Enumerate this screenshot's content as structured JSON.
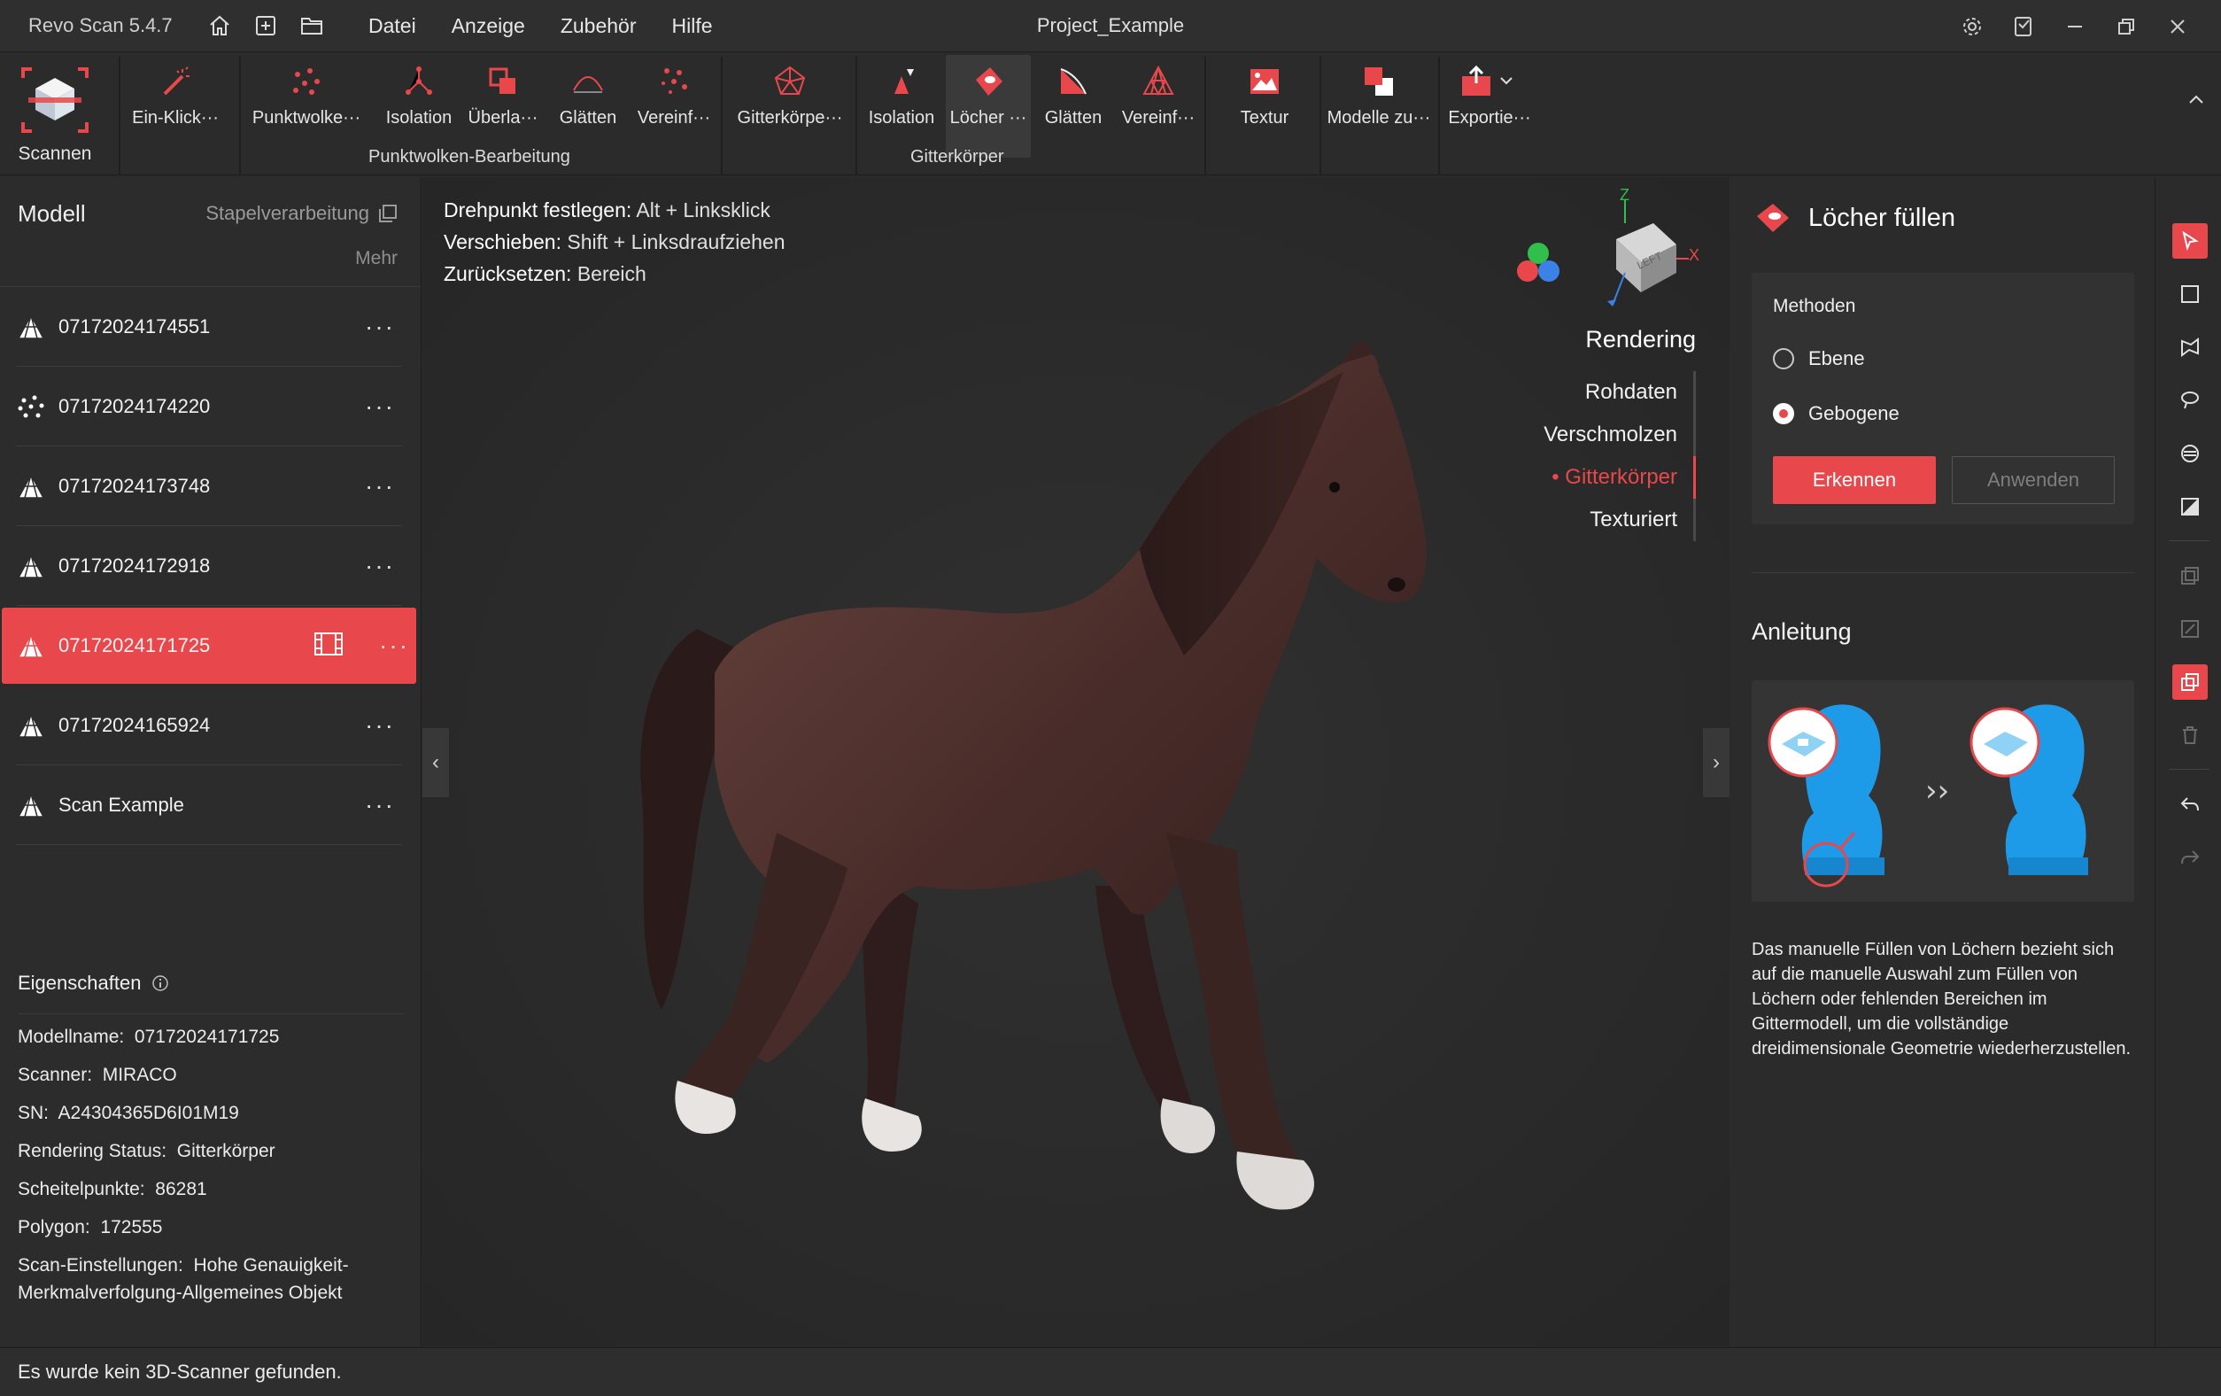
{
  "titlebar": {
    "app_title": "Revo Scan 5.4.7",
    "menu": [
      "Datei",
      "Anzeige",
      "Zubehör",
      "Hilfe"
    ],
    "project": "Project_Example"
  },
  "ribbon": {
    "scan_label": "Scannen",
    "tools": [
      {
        "label": "Ein-Klick···",
        "icon": "magic-wand-icon"
      },
      {
        "label": "Punktwolke···",
        "icon": "point-cloud-icon"
      },
      {
        "label": "Isolation",
        "icon": "isolation-icon"
      },
      {
        "label": "Überla···",
        "icon": "overlap-icon"
      },
      {
        "label": "Glätten",
        "icon": "smooth-icon"
      },
      {
        "label": "Vereinf···",
        "icon": "simplify-icon"
      },
      {
        "label": "Gitterkörpe···",
        "icon": "mesh-icon"
      },
      {
        "label": "Isolation",
        "icon": "mesh-isolation-icon"
      },
      {
        "label": "Löcher ···",
        "icon": "fill-holes-icon"
      },
      {
        "label": "Glätten",
        "icon": "mesh-smooth-icon"
      },
      {
        "label": "Vereinf···",
        "icon": "mesh-simplify-icon"
      },
      {
        "label": "Textur",
        "icon": "texture-icon"
      },
      {
        "label": "Modelle zu···",
        "icon": "merge-models-icon"
      },
      {
        "label": "Exportie···",
        "icon": "export-icon"
      }
    ],
    "groups": [
      "Punktwolken-Bearbeitung",
      "Gitterkörper"
    ]
  },
  "left_panel": {
    "title": "Modell",
    "batch": "Stapelverarbeitung",
    "more": "Mehr",
    "models": [
      {
        "name": "07172024174551",
        "icon": "mesh-triangle-icon"
      },
      {
        "name": "07172024174220",
        "icon": "point-cloud-icon"
      },
      {
        "name": "07172024173748",
        "icon": "mesh-triangle-icon"
      },
      {
        "name": "07172024172918",
        "icon": "mesh-triangle-icon"
      },
      {
        "name": "07172024171725",
        "icon": "mesh-triangle-icon"
      },
      {
        "name": "07172024165924",
        "icon": "mesh-triangle-icon"
      },
      {
        "name": "Scan Example",
        "icon": "mesh-triangle-icon"
      }
    ],
    "properties_title": "Eigenschaften",
    "properties": [
      {
        "label": "Modellname:",
        "value": "07172024171725"
      },
      {
        "label": "Scanner:",
        "value": "MIRACO"
      },
      {
        "label": "SN:",
        "value": "A24304365D6I01M19"
      },
      {
        "label": "Rendering Status:",
        "value": "Gitterkörper"
      },
      {
        "label": "Scheitelpunkte:",
        "value": "86281"
      },
      {
        "label": "Polygon:",
        "value": "172555"
      },
      {
        "label": "Scan-Einstellungen:",
        "value": "Hohe Genauigkeit-Merkmalverfolgung-Allgemeines Objekt"
      }
    ]
  },
  "viewport": {
    "hints": [
      {
        "label": "Drehpunkt festlegen:",
        "key": "Alt + Linksklick"
      },
      {
        "label": "Verschieben:",
        "key": "Shift + Linksdraufziehen"
      },
      {
        "label": "Zurücksetzen:",
        "key": "Bereich"
      }
    ],
    "cube_face": "LEFT",
    "axis_z": "Z",
    "axis_x": "X",
    "render_title": "Rendering",
    "render_options": [
      "Rohdaten",
      "Verschmolzen",
      "Gitterkörper",
      "Texturiert"
    ]
  },
  "right_panel": {
    "title": "Löcher füllen",
    "methods_title": "Methoden",
    "option_plane": "Ebene",
    "option_curved": "Gebogene",
    "detect": "Erkennen",
    "apply": "Anwenden",
    "guide_title": "Anleitung",
    "guide_text": "Das manuelle Füllen von Löchern bezieht sich auf die manuelle Auswahl zum Füllen von Löchern oder fehlenden Bereichen im Gittermodell, um die vollständige dreidimensionale Geometrie wiederherzustellen."
  },
  "status": "Es wurde kein 3D-Scanner gefunden.",
  "colors": {
    "accent": "#e8484b",
    "background": "#2a2a2a"
  }
}
